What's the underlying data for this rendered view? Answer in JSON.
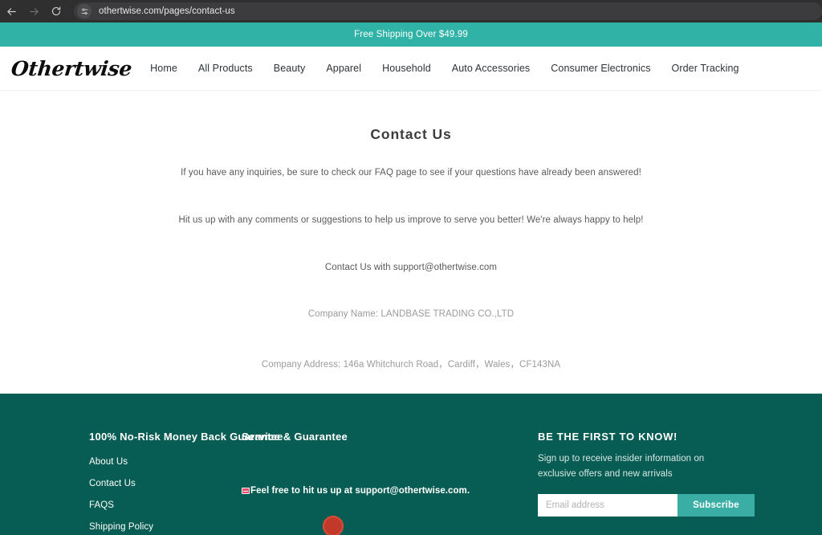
{
  "browser": {
    "back_icon": "back-arrow-icon",
    "forward_icon": "forward-arrow-icon",
    "reload_icon": "reload-icon",
    "site_info_icon": "page-settings-icon",
    "url": "othertwise.com/pages/contact-us"
  },
  "announcement": {
    "text": "Free Shipping Over $49.99",
    "bg": "#30b2a7"
  },
  "header": {
    "logo": "Othertwise",
    "nav": [
      {
        "label": "Home"
      },
      {
        "label": "All Products"
      },
      {
        "label": "Beauty"
      },
      {
        "label": "Apparel"
      },
      {
        "label": "Household"
      },
      {
        "label": "Auto Accessories"
      },
      {
        "label": "Consumer Electronics"
      },
      {
        "label": "Order Tracking"
      }
    ]
  },
  "main": {
    "title": "Contact Us",
    "paragraph_1": "If you have any inquiries, be sure to check our FAQ page to see if your questions have already been answered!",
    "paragraph_2": "Hit us up with any comments or suggestions to help us improve to serve you better! We're always happy to help!",
    "paragraph_3": "Contact Us with  support@othertwise.com",
    "company_name": "Company Name: LANDBASE TRADING CO.,LTD",
    "company_address": "Company Address: 146a Whitchurch Road，Cardiff，Wales，CF143NA"
  },
  "footer": {
    "bg": "#075d53",
    "col1": {
      "heading": "100% No-Risk Money Back Guarantee",
      "links": [
        {
          "label": "About Us"
        },
        {
          "label": "Contact Us"
        },
        {
          "label": "FAQS"
        },
        {
          "label": "Shipping Policy"
        }
      ]
    },
    "col2": {
      "heading": "Service & Guarantee",
      "note_icon": "email-emoji-icon",
      "note": "Feel free to hit us up at support@othertwise.com.",
      "badge_icon": "red-seal-icon"
    },
    "col3": {
      "heading": "BE THE FIRST TO KNOW!",
      "subtext": "Sign up to receive insider information on exclusive offers and new arrivals",
      "email_placeholder": "Email address",
      "email_value": "",
      "subscribe_label": "Subscribe",
      "subscribe_bg": "#3aada4"
    }
  }
}
